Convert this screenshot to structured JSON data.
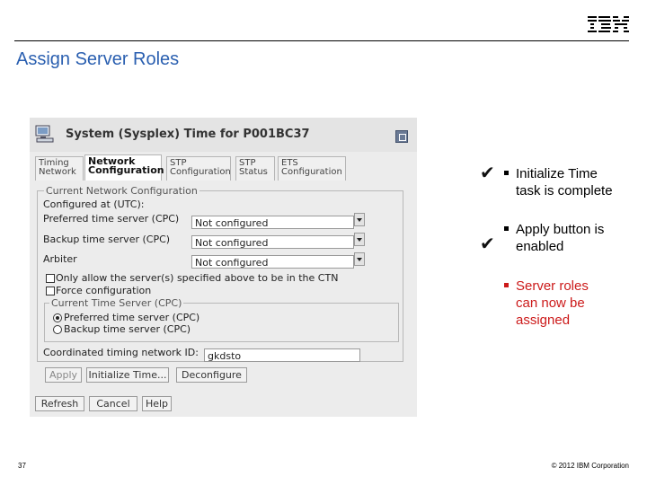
{
  "slide": {
    "title": "Assign Server Roles",
    "page_number": "37",
    "copyright": "© 2012 IBM Corporation",
    "logo_text": "IBM"
  },
  "window": {
    "title": "System (Sysplex) Time for P001BC37",
    "tabs": [
      {
        "line1": "Timing",
        "line2": "Network"
      },
      {
        "line1": "Network",
        "line2": "Configuration"
      },
      {
        "line1": "STP",
        "line2": "Configuration"
      },
      {
        "line1": "STP",
        "line2": "Status"
      },
      {
        "line1": "ETS",
        "line2": "Configuration"
      }
    ],
    "network_group_title": "Current Network Configuration",
    "configured_at_label": "Configured at (UTC):",
    "preferred_label": "Preferred time server (CPC)",
    "preferred_value": "Not configured",
    "backup_label": "Backup time server (CPC)",
    "backup_value": "Not configured",
    "arbiter_label": "Arbiter",
    "arbiter_value": "Not configured",
    "only_allow_label": "Only allow the server(s) specified above to be in the CTN",
    "force_label": "Force configuration",
    "cts_group_title": "Current Time Server (CPC)",
    "radio_preferred": "Preferred time server (CPC)",
    "radio_backup": "Backup time server (CPC)",
    "ctn_id_label": "Coordinated timing network ID:",
    "ctn_id_value": "gkdsto",
    "apply_button": "Apply",
    "initialize_button": "Initialize Time...",
    "deconfigure_button": "Deconfigure",
    "refresh_button": "Refresh",
    "cancel_button": "Cancel",
    "help_button": "Help"
  },
  "bullets": [
    {
      "line1": "Initialize Time",
      "line2": "task is complete",
      "checked": true
    },
    {
      "line1": "Apply button is",
      "line2": "enabled",
      "checked": true
    },
    {
      "line1": "Server roles",
      "line2": "can now be",
      "line3": "assigned",
      "color": "#cc1a1a"
    }
  ]
}
